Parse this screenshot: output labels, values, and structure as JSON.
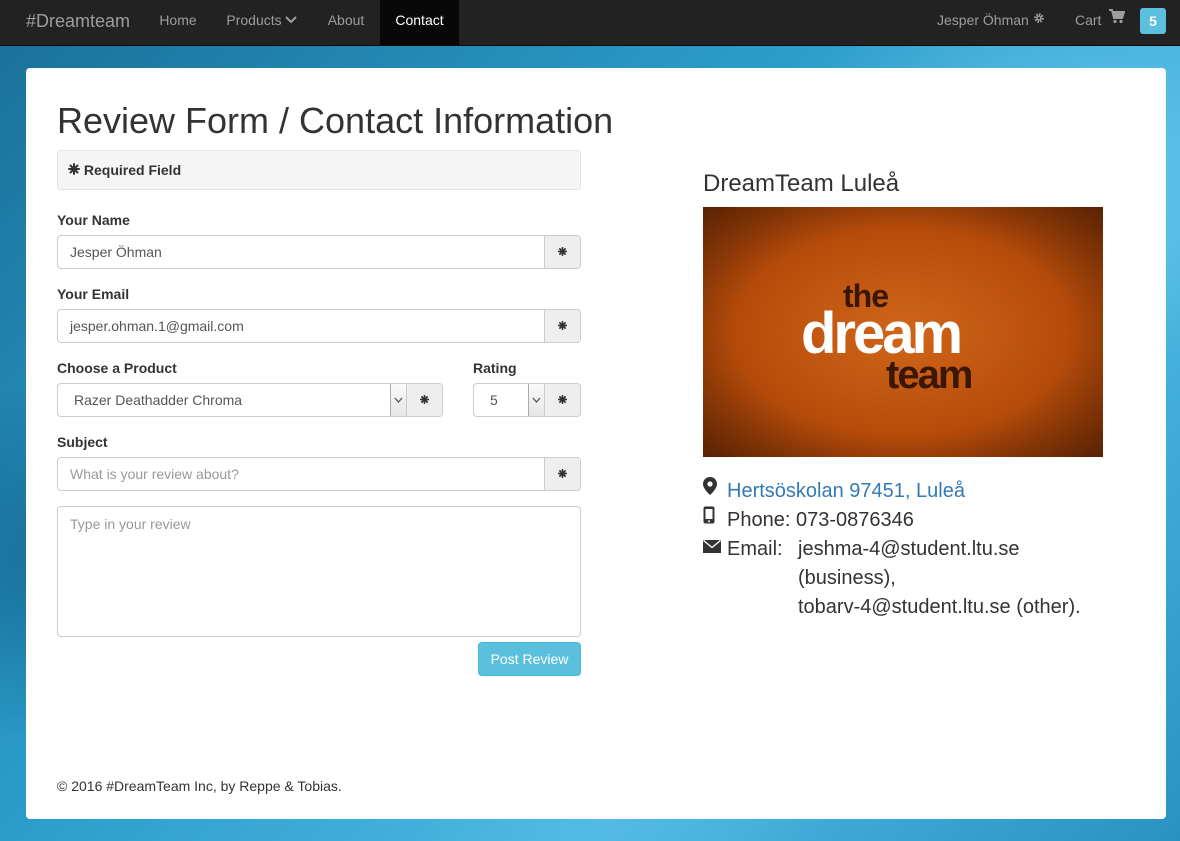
{
  "navbar": {
    "brand": "#Dreamteam",
    "items": [
      {
        "label": "Home"
      },
      {
        "label": "Products"
      },
      {
        "label": "About"
      },
      {
        "label": "Contact"
      }
    ],
    "user_name": "Jesper Öhman",
    "cart_label": "Cart",
    "cart_count": "5"
  },
  "form": {
    "title": "Review Form / Contact Information",
    "required_note": "Required Field",
    "name_label": "Your Name",
    "name_value": "Jesper Öhman",
    "email_label": "Your Email",
    "email_value": "jesper.ohman.1@gmail.com",
    "product_label": "Choose a Product",
    "product_value": "Razer Deathadder Chroma",
    "rating_label": "Rating",
    "rating_value": "5",
    "subject_label": "Subject",
    "subject_placeholder": "What is your review about?",
    "review_placeholder": "Type in your review",
    "submit_label": "Post Review"
  },
  "contact": {
    "heading": "DreamTeam Luleå",
    "image_words": [
      "the",
      "dream",
      "team"
    ],
    "address": "Hertsöskolan 97451, Luleå",
    "phone": "Phone: 073-0876346",
    "email_label": "Email:",
    "email_lines": [
      "jeshma-4@student.ltu.se",
      "(business),",
      "tobarv-4@student.ltu.se (other)."
    ]
  },
  "footer": {
    "text": "© 2016 #DreamTeam Inc, by Reppe & Tobias."
  },
  "colors": {
    "navbar_bg": "#222222",
    "accent_info": "#5bc0de",
    "link": "#337ab7"
  }
}
